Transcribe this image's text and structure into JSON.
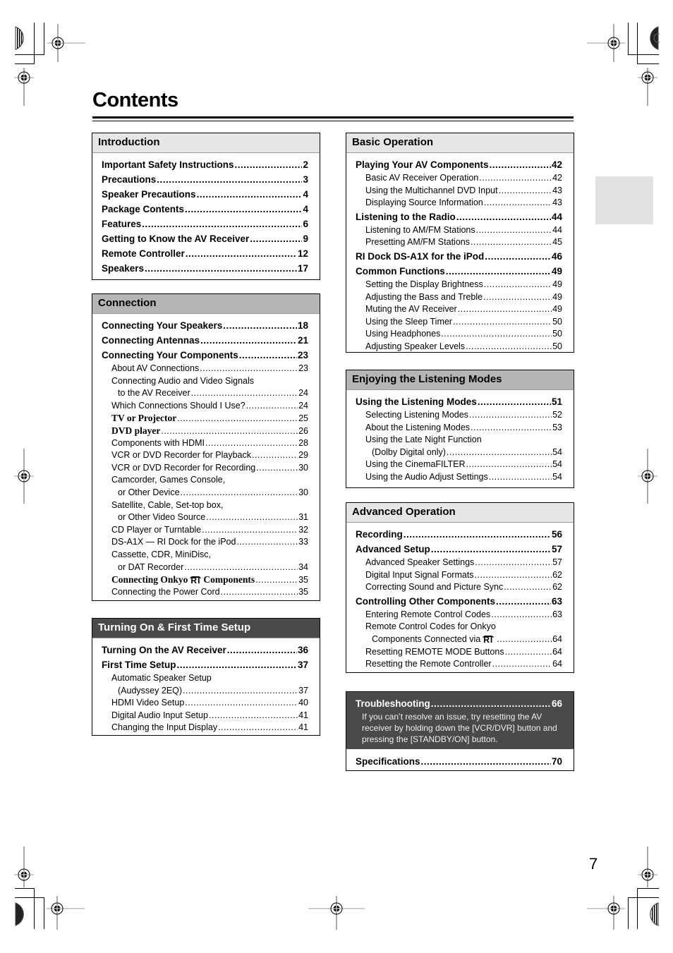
{
  "page": {
    "title": "Contents",
    "page_number": "7"
  },
  "sections": {
    "introduction": {
      "heading": "Introduction",
      "entries": [
        {
          "title": "Important Safety Instructions",
          "page": "2"
        },
        {
          "title": "Precautions",
          "page": "3"
        },
        {
          "title": "Speaker Precautions",
          "page": "4"
        },
        {
          "title": "Package Contents",
          "page": "4"
        },
        {
          "title": "Features",
          "page": "6"
        },
        {
          "title": "Getting to Know the AV Receiver",
          "page": "9"
        },
        {
          "title": "Remote Controller",
          "page": "12"
        },
        {
          "title": "Speakers",
          "page": "17"
        }
      ]
    },
    "connection": {
      "heading": "Connection",
      "entries": [
        {
          "title": "Connecting Your Speakers",
          "page": "18"
        },
        {
          "title": "Connecting Antennas",
          "page": "21"
        },
        {
          "title": "Connecting Your Components",
          "page": "23"
        },
        {
          "title": "About AV Connections",
          "page": "23"
        },
        {
          "title": "Connecting Audio and Video Signals",
          "title2": "to the AV Receiver",
          "page": "24"
        },
        {
          "title": "Which Connections Should I Use?",
          "page": "24"
        },
        {
          "title": "TV or Projector",
          "page": "25"
        },
        {
          "title": "DVD player",
          "page": "26"
        },
        {
          "title": "Components with HDMI",
          "page": "28"
        },
        {
          "title": "VCR or DVD Recorder for Playback",
          "page": "29"
        },
        {
          "title": "VCR or DVD Recorder for Recording",
          "page": "30"
        },
        {
          "title": "Camcorder, Games Console,",
          "title2": "or Other Device",
          "page": "30"
        },
        {
          "title": "Satellite, Cable, Set-top box,",
          "title2": "or Other Video Source",
          "page": "31"
        },
        {
          "title": "CD Player or Turntable",
          "page": "32"
        },
        {
          "title": "DS-A1X — RI Dock for the iPod",
          "page": "33"
        },
        {
          "title": "Cassette, CDR, MiniDisc,",
          "title2": "or DAT Recorder",
          "page": "34"
        },
        {
          "title": "Connecting Onkyo",
          "logo": "RI",
          "title_after": "Components",
          "page": "35"
        },
        {
          "title": "Connecting the Power Cord",
          "page": "35"
        }
      ]
    },
    "turning_on": {
      "heading": "Turning On & First Time Setup",
      "entries": [
        {
          "title": "Turning On the AV Receiver",
          "page": "36"
        },
        {
          "title": "First Time Setup",
          "page": "37"
        },
        {
          "title": "Automatic Speaker Setup",
          "title2": "(Audyssey 2EQ)",
          "page": "37"
        },
        {
          "title": "HDMI Video Setup",
          "page": "40"
        },
        {
          "title": "Digital Audio Input Setup",
          "page": "41"
        },
        {
          "title": "Changing the Input Display",
          "page": "41"
        }
      ]
    },
    "basic_operation": {
      "heading": "Basic Operation",
      "entries": [
        {
          "title": "Playing Your AV Components",
          "page": "42"
        },
        {
          "title": "Basic AV Receiver Operation",
          "page": "42"
        },
        {
          "title": "Using the Multichannel DVD Input",
          "page": "43"
        },
        {
          "title": "Displaying Source Information",
          "page": "43"
        },
        {
          "title": "Listening to the Radio",
          "page": "44"
        },
        {
          "title": "Listening to AM/FM Stations",
          "page": "44"
        },
        {
          "title": "Presetting AM/FM Stations",
          "page": "45"
        },
        {
          "title": "RI Dock DS-A1X for the iPod",
          "page": "46"
        },
        {
          "title": "Common Functions",
          "page": "49"
        },
        {
          "title": "Setting the Display Brightness",
          "page": "49"
        },
        {
          "title": "Adjusting the Bass and Treble",
          "page": "49"
        },
        {
          "title": "Muting the AV Receiver",
          "page": "49"
        },
        {
          "title": "Using the Sleep Timer",
          "page": "50"
        },
        {
          "title": "Using Headphones",
          "page": "50"
        },
        {
          "title": "Adjusting Speaker Levels",
          "page": "50"
        }
      ]
    },
    "listening_modes": {
      "heading": "Enjoying the Listening Modes",
      "entries": [
        {
          "title": "Using the Listening Modes",
          "page": "51"
        },
        {
          "title": "Selecting Listening Modes",
          "page": "52"
        },
        {
          "title": "About the Listening Modes",
          "page": "53"
        },
        {
          "title": "Using the Late Night Function",
          "title2": "(Dolby Digital only)",
          "page": "54"
        },
        {
          "title": "Using the CinemaFILTER",
          "page": "54"
        },
        {
          "title": "Using the Audio Adjust Settings",
          "page": "54"
        }
      ]
    },
    "advanced_operation": {
      "heading": "Advanced Operation",
      "entries": [
        {
          "title": "Recording",
          "page": "56"
        },
        {
          "title": "Advanced Setup",
          "page": "57"
        },
        {
          "title": "Advanced Speaker Settings",
          "page": "57"
        },
        {
          "title": "Digital Input Signal Formats",
          "page": "62"
        },
        {
          "title": "Correcting Sound and Picture Sync",
          "page": "62"
        },
        {
          "title": "Controlling Other Components",
          "page": "63"
        },
        {
          "title": "Entering Remote Control Codes",
          "page": "63"
        },
        {
          "title": "Remote Control Codes for Onkyo",
          "title2": "Components Connected via",
          "logo": "RI",
          "page": "64"
        },
        {
          "title": "Resetting REMOTE MODE Buttons",
          "page": "64"
        },
        {
          "title": "Resetting the Remote Controller",
          "page": "64"
        }
      ]
    },
    "troubleshooting": {
      "title": "Troubleshooting",
      "page": "66",
      "note": "If you can’t resolve an issue, try resetting the AV receiver by holding down the [VCR/DVR] button and pressing the [STANDBY/ON] button.",
      "specifications": {
        "title": "Specifications",
        "page": "70"
      }
    }
  },
  "colors": {
    "heading_light": "#e6e6e6",
    "heading_mid": "#b5b5b5",
    "heading_dark": "#4a4a4a",
    "side_tab": "#e2e2e2"
  }
}
